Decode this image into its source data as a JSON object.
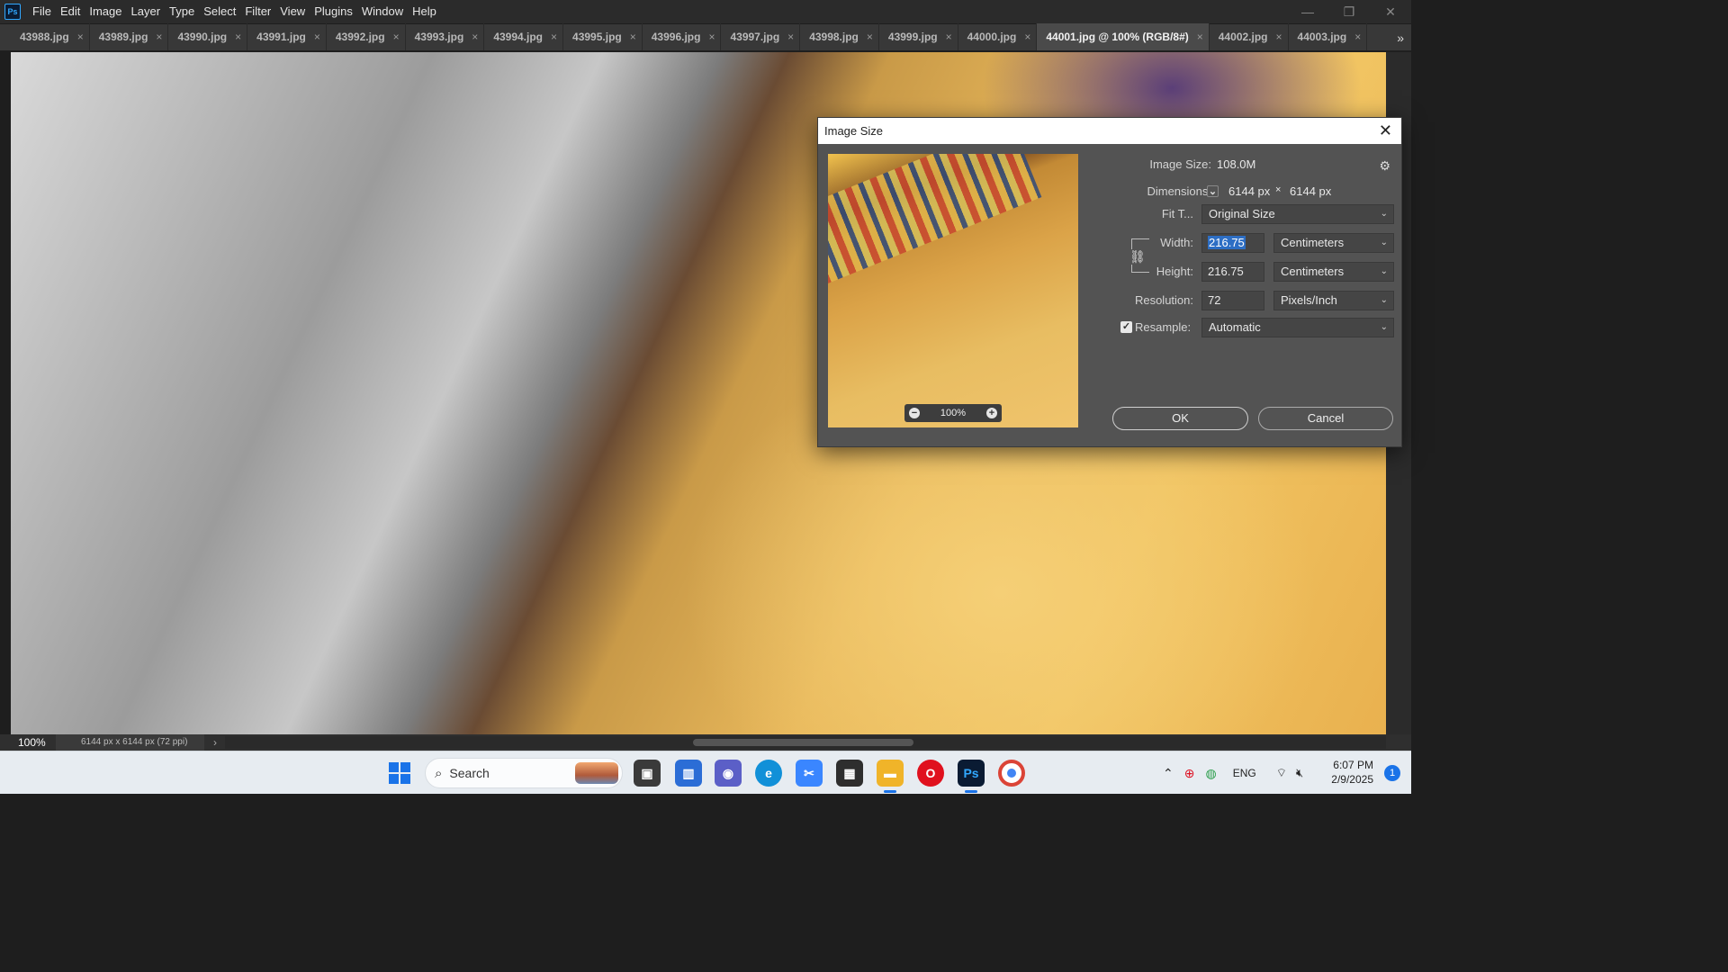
{
  "menu": {
    "logo": "Ps",
    "items": [
      "File",
      "Edit",
      "Image",
      "Layer",
      "Type",
      "Select",
      "Filter",
      "View",
      "Plugins",
      "Window",
      "Help"
    ]
  },
  "window_controls": {
    "minimize": "—",
    "restore": "❐",
    "close": "✕"
  },
  "tabs": [
    {
      "label": "43988.jpg",
      "active": false
    },
    {
      "label": "43989.jpg",
      "active": false
    },
    {
      "label": "43990.jpg",
      "active": false
    },
    {
      "label": "43991.jpg",
      "active": false
    },
    {
      "label": "43992.jpg",
      "active": false
    },
    {
      "label": "43993.jpg",
      "active": false
    },
    {
      "label": "43994.jpg",
      "active": false
    },
    {
      "label": "43995.jpg",
      "active": false
    },
    {
      "label": "43996.jpg",
      "active": false
    },
    {
      "label": "43997.jpg",
      "active": false
    },
    {
      "label": "43998.jpg",
      "active": false
    },
    {
      "label": "43999.jpg",
      "active": false
    },
    {
      "label": "44000.jpg",
      "active": false
    },
    {
      "label": "44001.jpg @ 100% (RGB/8#)",
      "active": true
    },
    {
      "label": "44002.jpg",
      "active": false
    },
    {
      "label": "44003.jpg",
      "active": false
    }
  ],
  "tab_close": "×",
  "tab_overflow": "»",
  "status": {
    "zoom": "100%",
    "doc_info": "6144 px x 6144 px (72 ppi)",
    "arrow": "›",
    "left_arrow": "‹",
    "right_arrow": "›"
  },
  "dialog": {
    "title": "Image Size",
    "close": "✕",
    "gear": "⚙",
    "preview_zoom": "100%",
    "zoom_out": "−",
    "zoom_in": "+",
    "image_size_label": "Image Size:",
    "image_size_value": "108.0M",
    "dimensions_label": "Dimensions:",
    "dimensions_width": "6144 px",
    "dimensions_sep": "×",
    "dimensions_height": "6144 px",
    "fit_label": "Fit T...",
    "fit_value": "Original Size",
    "width_label": "Width:",
    "width_value": "216.75",
    "width_unit": "Centimeters",
    "height_label": "Height:",
    "height_value": "216.75",
    "height_unit": "Centimeters",
    "resolution_label": "Resolution:",
    "resolution_value": "72",
    "resolution_unit": "Pixels/Inch",
    "resample_label": "Resample:",
    "resample_checked": true,
    "resample_value": "Automatic",
    "ok": "OK",
    "cancel": "Cancel"
  },
  "taskbar": {
    "search": "Search",
    "tray_lang": "ENG",
    "time": "6:07 PM",
    "date": "2/9/2025",
    "notifications": "1",
    "apps": [
      "task-view",
      "widgets",
      "teams",
      "edge",
      "snipping-tool",
      "store",
      "file-explorer",
      "opera",
      "photoshop",
      "chrome"
    ]
  }
}
